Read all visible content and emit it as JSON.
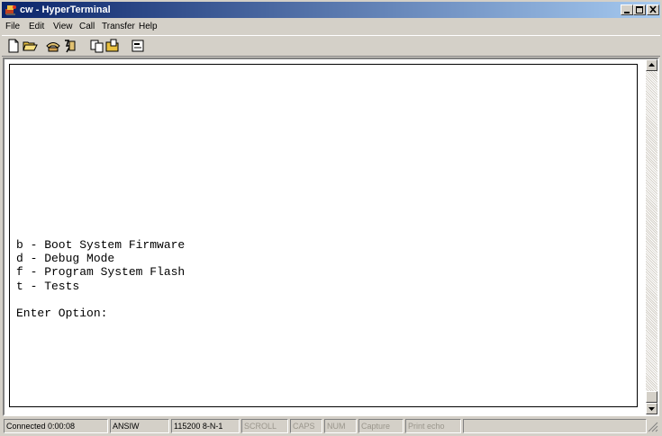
{
  "window": {
    "title": "cw - HyperTerminal"
  },
  "menubar": {
    "items": [
      {
        "label": "File"
      },
      {
        "label": "Edit"
      },
      {
        "label": "View"
      },
      {
        "label": "Call"
      },
      {
        "label": "Transfer"
      },
      {
        "label": "Help"
      }
    ]
  },
  "toolbar": {
    "buttons": [
      {
        "icon": "new-document-icon"
      },
      {
        "icon": "open-folder-icon"
      },
      {
        "icon": "call-phone-icon"
      },
      {
        "icon": "disconnect-phone-icon"
      },
      {
        "icon": "send-file-icon"
      },
      {
        "icon": "receive-file-icon"
      },
      {
        "icon": "properties-icon"
      }
    ]
  },
  "terminal": {
    "lines": [
      "b - Boot System Firmware",
      "d - Debug Mode",
      "f - Program System Flash",
      "t - Tests",
      "",
      "Enter Option:"
    ]
  },
  "statusbar": {
    "connected": "Connected 0:00:08",
    "emulation": "ANSIW",
    "settings": "115200 8-N-1",
    "scroll": "SCROLL",
    "caps": "CAPS",
    "num": "NUM",
    "capture": "Capture",
    "print_echo": "Print echo"
  },
  "colors": {
    "titlebar_start": "#0a246a",
    "titlebar_end": "#a6caf0",
    "chrome": "#d4d0c8",
    "terminal_bg": "#ffffff"
  }
}
